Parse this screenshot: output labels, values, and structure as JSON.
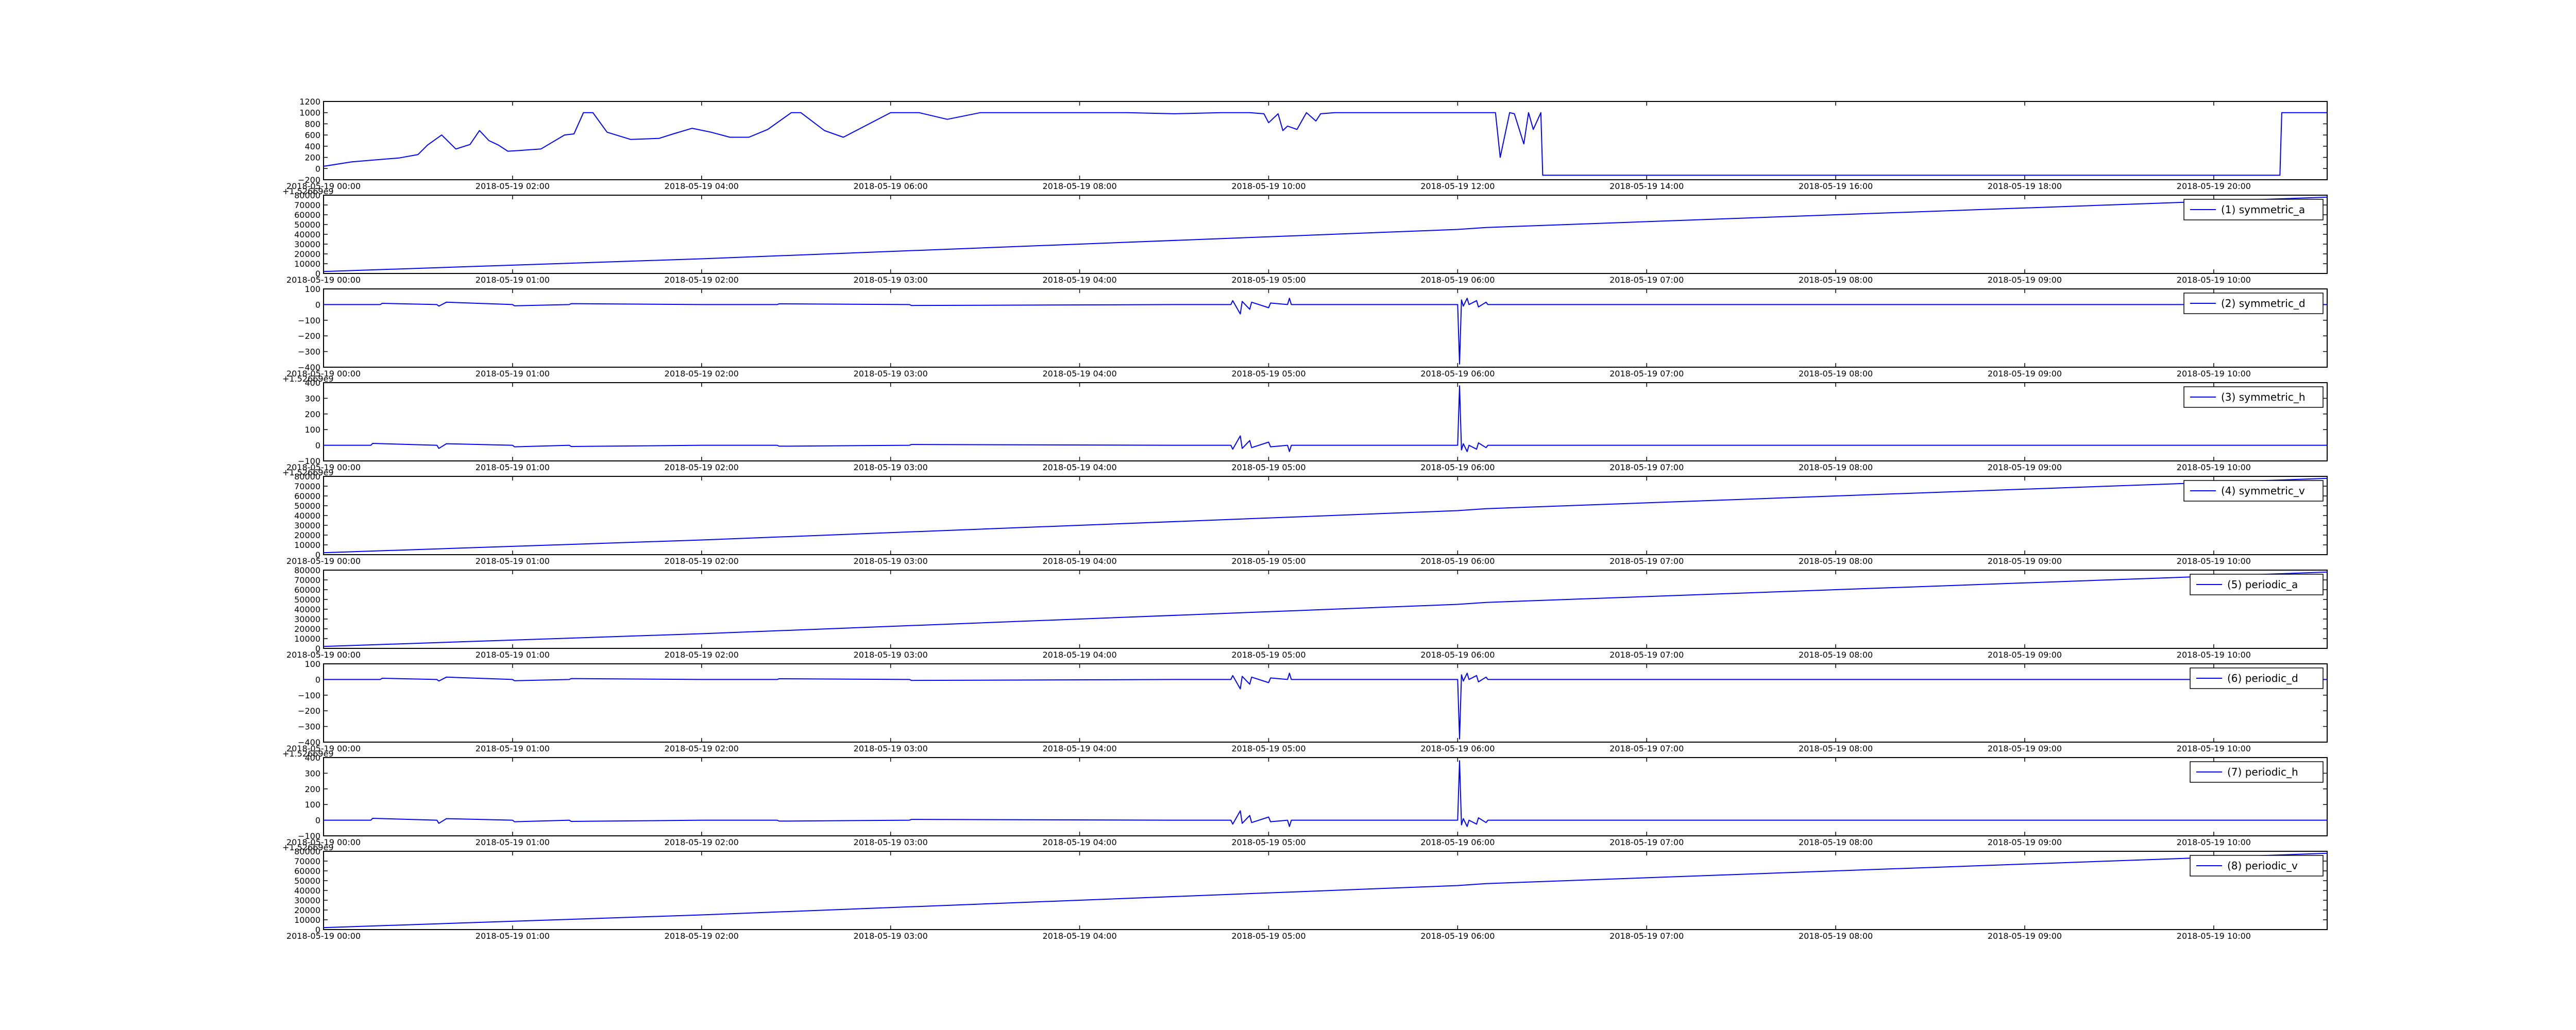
{
  "figure": {
    "colors": {
      "line": "#0000ff",
      "axis": "#000000",
      "background": "#ffffff"
    }
  },
  "chart_data": [
    {
      "type": "line",
      "legend": "",
      "ylim": [
        -200,
        1200
      ],
      "yticks": [
        "1200",
        "1000",
        "800",
        "600",
        "400",
        "200",
        "0",
        "−200"
      ],
      "xticks": [
        "2018-05-19 00:00",
        "2018-05-19 02:00",
        "2018-05-19 04:00",
        "2018-05-19 06:00",
        "2018-05-19 08:00",
        "2018-05-19 10:00",
        "2018-05-19 12:00",
        "2018-05-19 14:00",
        "2018-05-19 16:00",
        "2018-05-19 18:00",
        "2018-05-19 20:00"
      ],
      "x_hours": [
        0,
        21.2
      ],
      "y_offset": "",
      "x": [
        0,
        0.3,
        0.8,
        1.0,
        1.1,
        1.25,
        1.4,
        1.55,
        1.65,
        1.75,
        1.85,
        1.95,
        2.05,
        2.3,
        2.55,
        2.65,
        2.75,
        2.85,
        3.0,
        3.25,
        3.55,
        3.7,
        3.9,
        4.1,
        4.3,
        4.5,
        4.7,
        4.95,
        5.05,
        5.3,
        5.5,
        6.0,
        6.3,
        6.6,
        6.95,
        7.05,
        7.2,
        7.45,
        7.6,
        7.8,
        8.0,
        8.5,
        9.0,
        9.5,
        9.8,
        9.95,
        10.0,
        10.1,
        10.15,
        10.2,
        10.3,
        10.4,
        10.5,
        10.55,
        10.7,
        11.0,
        11.5,
        12.0,
        12.4,
        12.45,
        12.55,
        12.6,
        12.7,
        12.75,
        12.8,
        12.88,
        12.9,
        14.0,
        16.0,
        18.0,
        20.0,
        20.7,
        20.72,
        21.2
      ],
      "values": [
        40,
        120,
        190,
        250,
        420,
        600,
        350,
        430,
        680,
        500,
        420,
        310,
        320,
        350,
        600,
        620,
        1000,
        1000,
        650,
        520,
        540,
        620,
        720,
        650,
        560,
        560,
        700,
        1000,
        1000,
        680,
        560,
        1000,
        1000,
        880,
        1000,
        1000,
        1000,
        1000,
        1000,
        1000,
        1000,
        1000,
        980,
        1000,
        1000,
        980,
        820,
        980,
        680,
        760,
        700,
        1000,
        850,
        980,
        1000,
        1000,
        1000,
        1000,
        1000,
        200,
        1000,
        980,
        440,
        1000,
        700,
        1000,
        -120,
        -120,
        -120,
        -120,
        -120,
        -120,
        1000,
        1000
      ]
    },
    {
      "type": "line",
      "legend": "(1) symmetric_a",
      "ylim": [
        0,
        80000
      ],
      "yticks": [
        "80000",
        "70000",
        "60000",
        "50000",
        "40000",
        "30000",
        "20000",
        "10000",
        "0"
      ],
      "xticks": [
        "2018-05-19 00:00",
        "2018-05-19 01:00",
        "2018-05-19 02:00",
        "2018-05-19 03:00",
        "2018-05-19 04:00",
        "2018-05-19 05:00",
        "2018-05-19 06:00",
        "2018-05-19 07:00",
        "2018-05-19 08:00",
        "2018-05-19 09:00",
        "2018-05-19 10:00"
      ],
      "x_hours": [
        0,
        10.6
      ],
      "y_offset": "+1.52669e9",
      "x": [
        0,
        2,
        4,
        6,
        6.15,
        8,
        10.6
      ],
      "values": [
        2000,
        15000,
        30000,
        45000,
        47000,
        60000,
        78000
      ]
    },
    {
      "type": "line",
      "legend": "(2) symmetric_d",
      "ylim": [
        -400,
        100
      ],
      "yticks": [
        "100",
        "0",
        "−100",
        "−200",
        "−300",
        "−400"
      ],
      "xticks": [
        "2018-05-19 00:00",
        "2018-05-19 01:00",
        "2018-05-19 02:00",
        "2018-05-19 03:00",
        "2018-05-19 04:00",
        "2018-05-19 05:00",
        "2018-05-19 06:00",
        "2018-05-19 07:00",
        "2018-05-19 08:00",
        "2018-05-19 09:00",
        "2018-05-19 10:00"
      ],
      "x_hours": [
        0,
        10.6
      ],
      "y_offset": "",
      "x": [
        0,
        0.3,
        0.31,
        0.6,
        0.61,
        0.65,
        1.0,
        1.01,
        1.3,
        1.31,
        2.0,
        2.4,
        2.41,
        3.1,
        3.11,
        4.5,
        4.8,
        4.81,
        4.85,
        4.86,
        4.9,
        4.91,
        5.0,
        5.01,
        5.1,
        5.11,
        5.12,
        6.0,
        6.01,
        6.02,
        6.03,
        6.05,
        6.06,
        6.1,
        6.11,
        6.15,
        6.16,
        10.6
      ],
      "values": [
        0,
        0,
        8,
        0,
        -10,
        15,
        0,
        -8,
        0,
        6,
        0,
        0,
        5,
        0,
        -6,
        0,
        0,
        25,
        -60,
        20,
        -30,
        15,
        -20,
        10,
        0,
        40,
        0,
        0,
        -380,
        30,
        -10,
        40,
        0,
        25,
        -15,
        15,
        0,
        0
      ]
    },
    {
      "type": "line",
      "legend": "(3) symmetric_h",
      "ylim": [
        -100,
        400
      ],
      "yticks": [
        "400",
        "300",
        "200",
        "100",
        "0",
        "−100"
      ],
      "xticks": [
        "2018-05-19 00:00",
        "2018-05-19 01:00",
        "2018-05-19 02:00",
        "2018-05-19 03:00",
        "2018-05-19 04:00",
        "2018-05-19 05:00",
        "2018-05-19 06:00",
        "2018-05-19 07:00",
        "2018-05-19 08:00",
        "2018-05-19 09:00",
        "2018-05-19 10:00"
      ],
      "x_hours": [
        0,
        10.6
      ],
      "y_offset": "+1.52669e9",
      "x": [
        0,
        0.25,
        0.26,
        0.6,
        0.61,
        0.65,
        1.0,
        1.01,
        1.3,
        1.31,
        2.0,
        2.4,
        2.41,
        3.1,
        3.11,
        4.5,
        4.8,
        4.81,
        4.85,
        4.86,
        4.9,
        4.91,
        5.0,
        5.01,
        5.1,
        5.11,
        5.12,
        6.0,
        6.01,
        6.02,
        6.03,
        6.05,
        6.06,
        6.1,
        6.11,
        6.15,
        6.16,
        10.6
      ],
      "values": [
        0,
        0,
        12,
        0,
        -20,
        10,
        0,
        -10,
        0,
        -8,
        0,
        0,
        -6,
        0,
        5,
        0,
        0,
        -25,
        60,
        -20,
        30,
        -15,
        20,
        -10,
        0,
        -40,
        0,
        0,
        380,
        -30,
        10,
        -40,
        0,
        -25,
        15,
        -15,
        0,
        0
      ]
    },
    {
      "type": "line",
      "legend": "(4) symmetric_v",
      "ylim": [
        0,
        80000
      ],
      "yticks": [
        "80000",
        "70000",
        "60000",
        "50000",
        "40000",
        "30000",
        "20000",
        "10000",
        "0"
      ],
      "xticks": [
        "2018-05-19 00:00",
        "2018-05-19 01:00",
        "2018-05-19 02:00",
        "2018-05-19 03:00",
        "2018-05-19 04:00",
        "2018-05-19 05:00",
        "2018-05-19 06:00",
        "2018-05-19 07:00",
        "2018-05-19 08:00",
        "2018-05-19 09:00",
        "2018-05-19 10:00"
      ],
      "x_hours": [
        0,
        10.6
      ],
      "y_offset": "+1.52669e9",
      "x": [
        0,
        2,
        4,
        6,
        6.15,
        8,
        10.6
      ],
      "values": [
        2000,
        15000,
        30000,
        45000,
        47000,
        60000,
        78000
      ]
    },
    {
      "type": "line",
      "legend": "(5) periodic_a",
      "ylim": [
        0,
        80000
      ],
      "yticks": [
        "80000",
        "70000",
        "60000",
        "50000",
        "40000",
        "30000",
        "20000",
        "10000",
        "0"
      ],
      "xticks": [
        "2018-05-19 00:00",
        "2018-05-19 01:00",
        "2018-05-19 02:00",
        "2018-05-19 03:00",
        "2018-05-19 04:00",
        "2018-05-19 05:00",
        "2018-05-19 06:00",
        "2018-05-19 07:00",
        "2018-05-19 08:00",
        "2018-05-19 09:00",
        "2018-05-19 10:00"
      ],
      "x_hours": [
        0,
        10.6
      ],
      "y_offset": "",
      "x": [
        0,
        2,
        4,
        6,
        6.15,
        8,
        10.6
      ],
      "values": [
        2000,
        15000,
        30000,
        45000,
        47000,
        60000,
        78000
      ]
    },
    {
      "type": "line",
      "legend": "(6) periodic_d",
      "ylim": [
        -400,
        100
      ],
      "yticks": [
        "100",
        "0",
        "−100",
        "−200",
        "−300",
        "−400"
      ],
      "xticks": [
        "2018-05-19 00:00",
        "2018-05-19 01:00",
        "2018-05-19 02:00",
        "2018-05-19 03:00",
        "2018-05-19 04:00",
        "2018-05-19 05:00",
        "2018-05-19 06:00",
        "2018-05-19 07:00",
        "2018-05-19 08:00",
        "2018-05-19 09:00",
        "2018-05-19 10:00"
      ],
      "x_hours": [
        0,
        10.6
      ],
      "y_offset": "",
      "x": [
        0,
        0.3,
        0.31,
        0.6,
        0.61,
        0.65,
        1.0,
        1.01,
        1.3,
        1.31,
        2.0,
        2.4,
        2.41,
        3.1,
        3.11,
        4.5,
        4.8,
        4.81,
        4.85,
        4.86,
        4.9,
        4.91,
        5.0,
        5.01,
        5.1,
        5.11,
        5.12,
        6.0,
        6.01,
        6.02,
        6.03,
        6.05,
        6.06,
        6.1,
        6.11,
        6.15,
        6.16,
        10.6
      ],
      "values": [
        0,
        0,
        8,
        0,
        -10,
        15,
        0,
        -8,
        0,
        6,
        0,
        0,
        5,
        0,
        -6,
        0,
        0,
        25,
        -60,
        20,
        -30,
        15,
        -20,
        10,
        0,
        40,
        0,
        0,
        -380,
        30,
        -10,
        40,
        0,
        25,
        -15,
        15,
        0,
        0
      ]
    },
    {
      "type": "line",
      "legend": "(7) periodic_h",
      "ylim": [
        -100,
        400
      ],
      "yticks": [
        "400",
        "300",
        "200",
        "100",
        "0",
        "−100"
      ],
      "xticks": [
        "2018-05-19 00:00",
        "2018-05-19 01:00",
        "2018-05-19 02:00",
        "2018-05-19 03:00",
        "2018-05-19 04:00",
        "2018-05-19 05:00",
        "2018-05-19 06:00",
        "2018-05-19 07:00",
        "2018-05-19 08:00",
        "2018-05-19 09:00",
        "2018-05-19 10:00"
      ],
      "x_hours": [
        0,
        10.6
      ],
      "y_offset": "+1.52669e9",
      "x": [
        0,
        0.25,
        0.26,
        0.6,
        0.61,
        0.65,
        1.0,
        1.01,
        1.3,
        1.31,
        2.0,
        2.4,
        2.41,
        3.1,
        3.11,
        4.5,
        4.8,
        4.81,
        4.85,
        4.86,
        4.9,
        4.91,
        5.0,
        5.01,
        5.1,
        5.11,
        5.12,
        6.0,
        6.01,
        6.02,
        6.03,
        6.05,
        6.06,
        6.1,
        6.11,
        6.15,
        6.16,
        10.6
      ],
      "values": [
        0,
        0,
        12,
        0,
        -20,
        10,
        0,
        -10,
        0,
        -8,
        0,
        0,
        -6,
        0,
        5,
        0,
        0,
        -25,
        60,
        -20,
        30,
        -15,
        20,
        -10,
        0,
        -40,
        0,
        0,
        380,
        -30,
        10,
        -40,
        0,
        -25,
        15,
        -15,
        0,
        0
      ]
    },
    {
      "type": "line",
      "legend": "(8) periodic_v",
      "ylim": [
        0,
        80000
      ],
      "yticks": [
        "80000",
        "70000",
        "60000",
        "50000",
        "40000",
        "30000",
        "20000",
        "10000",
        "0"
      ],
      "xticks": [
        "2018-05-19 00:00",
        "2018-05-19 01:00",
        "2018-05-19 02:00",
        "2018-05-19 03:00",
        "2018-05-19 04:00",
        "2018-05-19 05:00",
        "2018-05-19 06:00",
        "2018-05-19 07:00",
        "2018-05-19 08:00",
        "2018-05-19 09:00",
        "2018-05-19 10:00"
      ],
      "x_hours": [
        0,
        10.6
      ],
      "y_offset": "+1.52669e9",
      "x": [
        0,
        2,
        4,
        6,
        6.15,
        8,
        10.6
      ],
      "values": [
        2000,
        15000,
        30000,
        45000,
        47000,
        60000,
        78000
      ]
    }
  ]
}
